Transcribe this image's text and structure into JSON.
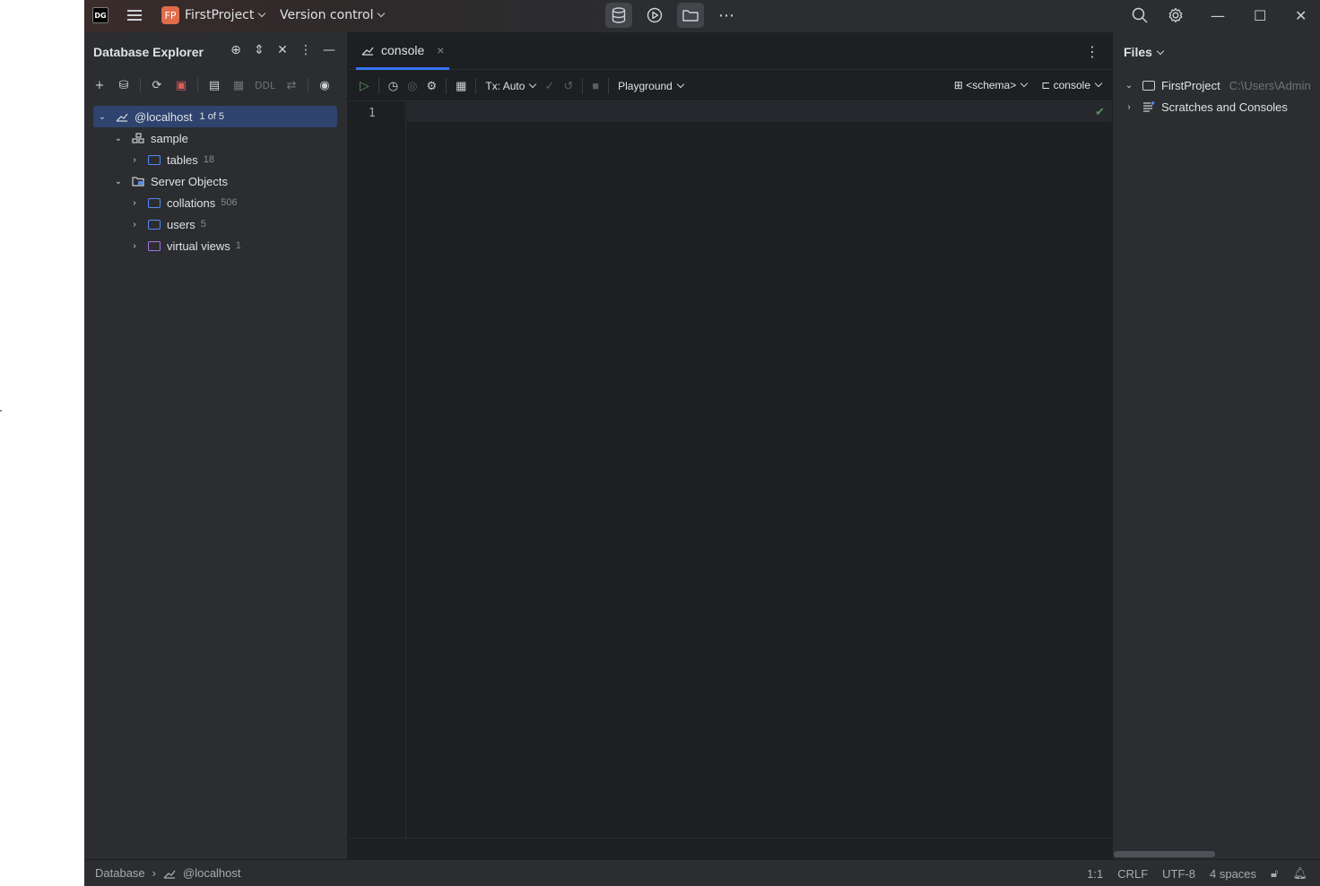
{
  "titlebar": {
    "logo": "DG",
    "project_badge": "FP",
    "project_name": "FirstProject",
    "version_control": "Version control",
    "icons": [
      "database-icon",
      "run-icon",
      "folder-icon",
      "more-icon",
      "search-icon",
      "settings-icon"
    ],
    "window_controls": [
      "minimize",
      "maximize",
      "close"
    ]
  },
  "left_panel": {
    "title": "Database Explorer",
    "toolbar": {
      "ddl_label": "DDL"
    },
    "tree": [
      {
        "label": "@localhost",
        "badge": "1 of 5",
        "level": 0,
        "expanded": true,
        "selected": true
      },
      {
        "label": "sample",
        "count": "",
        "level": 1,
        "expanded": true
      },
      {
        "label": "tables",
        "count": "18",
        "level": 2,
        "expanded": false
      },
      {
        "label": "Server Objects",
        "count": "",
        "level": 1,
        "expanded": true
      },
      {
        "label": "collations",
        "count": "506",
        "level": 2,
        "expanded": false
      },
      {
        "label": "users",
        "count": "5",
        "level": 2,
        "expanded": false
      },
      {
        "label": "virtual views",
        "count": "1",
        "level": 2,
        "expanded": false
      }
    ]
  },
  "editor": {
    "tab_label": "console",
    "tx_label": "Tx: Auto",
    "playground_label": "Playground",
    "schema_label": "<schema>",
    "session_label": "console",
    "line_number": "1"
  },
  "right_panel": {
    "title": "Files",
    "tree": [
      {
        "label": "FirstProject",
        "path": "C:\\Users\\Admin",
        "expanded": true
      },
      {
        "label": "Scratches and Consoles",
        "expanded": false
      }
    ]
  },
  "statusbar": {
    "breadcrumb_root": "Database",
    "breadcrumb_leaf": "@localhost",
    "position": "1:1",
    "line_ending": "CRLF",
    "encoding": "UTF-8",
    "indent": "4 spaces"
  }
}
